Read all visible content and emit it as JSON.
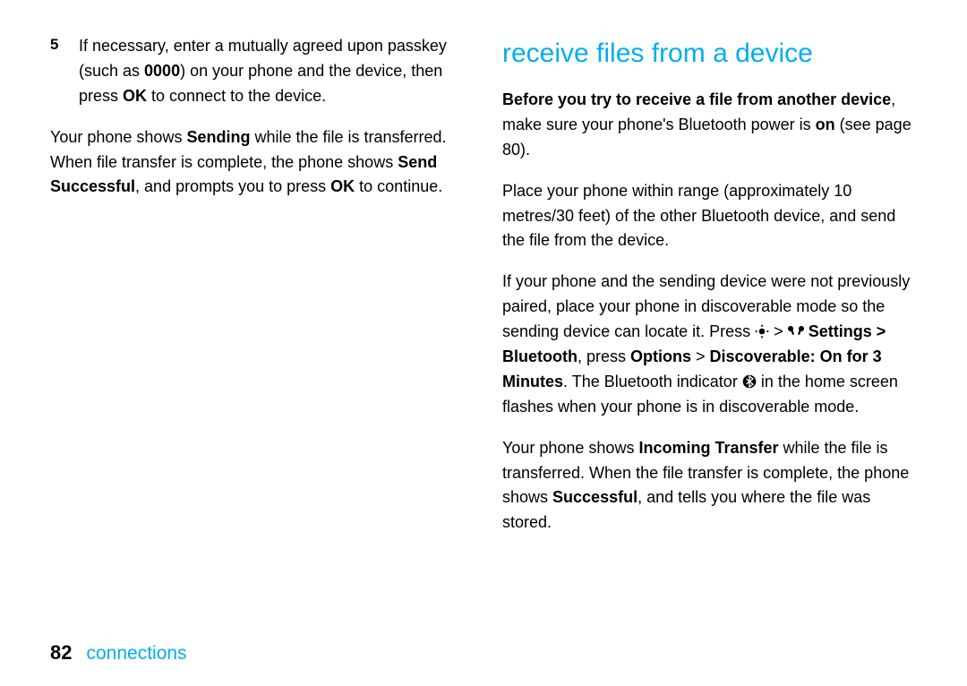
{
  "left": {
    "step_num": "5",
    "step_a": "If necessary, enter a mutually agreed upon passkey (such as ",
    "step_passkey": "0000",
    "step_b": ") on your phone and the device, then press ",
    "step_ok": "OK",
    "step_c": " to connect to the device.",
    "p2_a": "Your phone shows ",
    "p2_sending": "Sending",
    "p2_b": " while the file is transferred. When file transfer is complete, the phone shows ",
    "p2_send_successful": "Send Successful",
    "p2_c": ", and prompts you to press ",
    "p2_ok": "OK",
    "p2_d": " to continue."
  },
  "right": {
    "title": "receive files from a device",
    "p1_bold": "Before you try to receive a file from another device",
    "p1_a": ", make sure your phone's Bluetooth power is ",
    "p1_on": "on",
    "p1_b": " (see page 80).",
    "p2": "Place your phone within range (approximately 10 metres/30 feet) of the other Bluetooth device, and send the file from the device.",
    "p3_a": "If your phone and the sending device were not previously paired, place your phone in discoverable mode so the sending device can locate it. Press ",
    "p3_nav": " Settings > Bluetooth",
    "p3_press": ", press ",
    "p3_options": "Options",
    "p3_gt": " > ",
    "p3_discoverable": "Discoverable: On for 3 Minutes",
    "p3_b": ". The Bluetooth indicator ",
    "p3_c": " in the home screen flashes when your phone is in discoverable mode.",
    "p4_a": "Your phone shows ",
    "p4_incoming": "Incoming Transfer",
    "p4_b": " while the file is transferred. When the file transfer is complete, the phone shows ",
    "p4_successful": "Successful",
    "p4_c": ", and tells you where the file was stored."
  },
  "footer": {
    "page": "82",
    "label": "connections"
  }
}
